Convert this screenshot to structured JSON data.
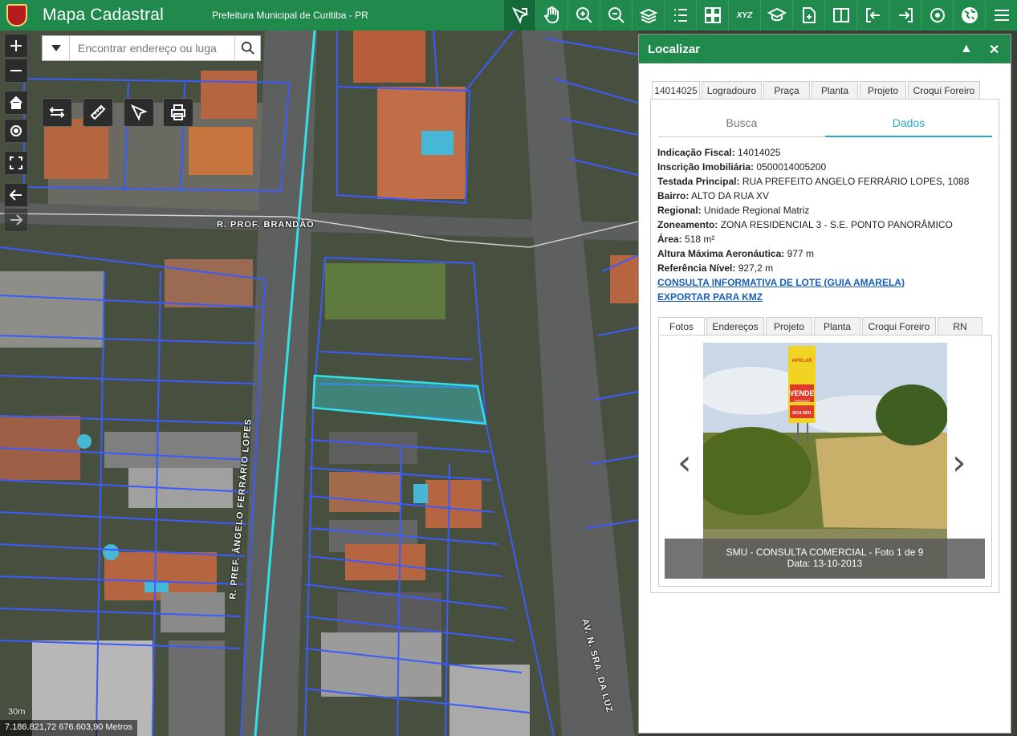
{
  "topbar": {
    "app_title": "Mapa Cadastral",
    "app_subtitle": "Prefeitura Municipal de Curitiba - PR",
    "tools": [
      {
        "icon": "identify-icon",
        "active": true
      },
      {
        "icon": "pan-hand-icon"
      },
      {
        "icon": "zoom-in-icon"
      },
      {
        "icon": "zoom-out-icon"
      },
      {
        "icon": "layers-icon"
      },
      {
        "icon": "list-icon"
      },
      {
        "icon": "grid-icon"
      },
      {
        "icon": "xyz-icon",
        "text": "XYZ"
      },
      {
        "icon": "graduation-cap-icon"
      },
      {
        "icon": "add-document-icon"
      },
      {
        "icon": "split-view-icon"
      },
      {
        "icon": "import-icon"
      },
      {
        "icon": "export-icon"
      },
      {
        "icon": "location-dot-icon"
      },
      {
        "icon": "globe-icon"
      },
      {
        "icon": "menu-icon"
      }
    ]
  },
  "map": {
    "search_placeholder": "Encontrar endereço ou luga",
    "street_labels": {
      "prof_brandao": "R. PROF. BRANDÃO",
      "angelo_ferrario": "R. PREF. ÂNGELO FERRÁRIO LOPES",
      "sra_da_luz": "AV. N. SRA. DA LUZ"
    },
    "coordinates": "7.186.821,72 676.603,90 Metros",
    "scale": "30m"
  },
  "panel": {
    "title": "Localizar",
    "top_tabs": [
      "14014025",
      "Logradouro",
      "Praça",
      "Planta",
      "Projeto",
      "Croqui Foreiro"
    ],
    "sub_tabs": [
      "Busca",
      "Dados"
    ],
    "fields": [
      {
        "label": "Indicação Fiscal:",
        "value": "14014025"
      },
      {
        "label": "Inscrição Imobiliária:",
        "value": "0500014005200"
      },
      {
        "label": "Testada Principal:",
        "value": "RUA PREFEITO ANGELO FERRÁRIO LOPES, 1088"
      },
      {
        "label": "Bairro:",
        "value": "ALTO DA RUA XV"
      },
      {
        "label": "Regional:",
        "value": "Unidade Regional Matriz"
      },
      {
        "label": "Zoneamento:",
        "value": "ZONA RESIDENCIAL 3 - S.E. PONTO PANORÂMICO"
      },
      {
        "label": "Área:",
        "value": "518 m²"
      },
      {
        "label": "Altura Máxima Aeronáutica:",
        "value": "977 m"
      },
      {
        "label": "Referência Nível:",
        "value": "927,2 m"
      }
    ],
    "links": [
      "CONSULTA INFORMATIVA DE LOTE (GUIA AMARELA)",
      "EXPORTAR PARA KMZ"
    ],
    "photo_tabs": [
      "Fotos",
      "Endereços",
      "Projeto",
      "Planta",
      "Croqui Foreiro",
      "RN"
    ],
    "photo": {
      "sign_brand": "APOLAR",
      "sign_sale": "VENDE",
      "sign_sub": "TERRENO",
      "sign_phone": "3014-3031",
      "caption_line1": "SMU - CONSULTA COMERCIAL - Foto 1 de 9",
      "caption_line2": "Data: 13-10-2013"
    }
  }
}
